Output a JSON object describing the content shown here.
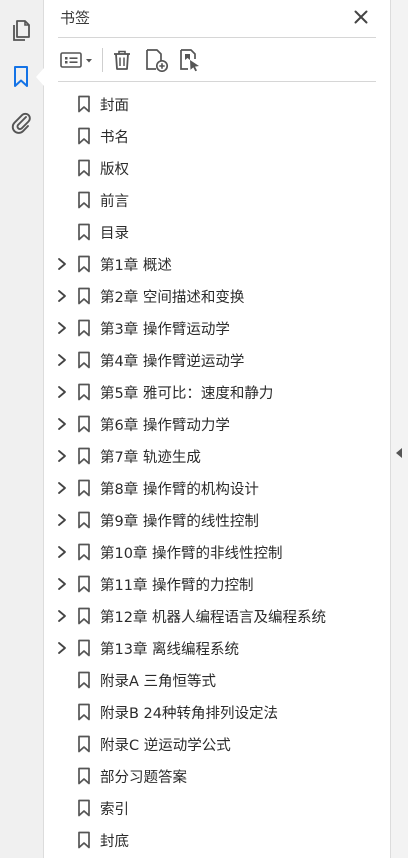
{
  "panel": {
    "title": "书签"
  },
  "rail": [
    {
      "name": "pages-icon",
      "active": false
    },
    {
      "name": "bookmark-icon",
      "active": true
    },
    {
      "name": "attachment-icon",
      "active": false
    }
  ],
  "toolbar": [
    "options-menu-icon",
    "delete-icon",
    "new-bookmark-icon",
    "bookmark-from-selection-icon"
  ],
  "colors": {
    "accent": "#1473e6",
    "icon": "#555555"
  },
  "bookmarks": [
    {
      "label": "封面",
      "expandable": false
    },
    {
      "label": "书名",
      "expandable": false
    },
    {
      "label": "版权",
      "expandable": false
    },
    {
      "label": "前言",
      "expandable": false
    },
    {
      "label": "目录",
      "expandable": false
    },
    {
      "label": "第1章  概述",
      "expandable": true
    },
    {
      "label": "第2章  空间描述和变换",
      "expandable": true
    },
    {
      "label": "第3章  操作臂运动学",
      "expandable": true
    },
    {
      "label": "第4章  操作臂逆运动学",
      "expandable": true
    },
    {
      "label": "第5章  雅可比：速度和静力",
      "expandable": true
    },
    {
      "label": "第6章  操作臂动力学",
      "expandable": true
    },
    {
      "label": "第7章  轨迹生成",
      "expandable": true
    },
    {
      "label": "第8章  操作臂的机构设计",
      "expandable": true
    },
    {
      "label": "第9章  操作臂的线性控制",
      "expandable": true
    },
    {
      "label": "第10章  操作臂的非线性控制",
      "expandable": true
    },
    {
      "label": "第11章  操作臂的力控制",
      "expandable": true
    },
    {
      "label": "第12章  机器人编程语言及编程系统",
      "expandable": true
    },
    {
      "label": "第13章  离线编程系统",
      "expandable": true
    },
    {
      "label": "附录A  三角恒等式",
      "expandable": false
    },
    {
      "label": "附录B  24种转角排列设定法",
      "expandable": false
    },
    {
      "label": "附录C  逆运动学公式",
      "expandable": false
    },
    {
      "label": "部分习题答案",
      "expandable": false
    },
    {
      "label": "索引",
      "expandable": false
    },
    {
      "label": "封底",
      "expandable": false
    }
  ]
}
